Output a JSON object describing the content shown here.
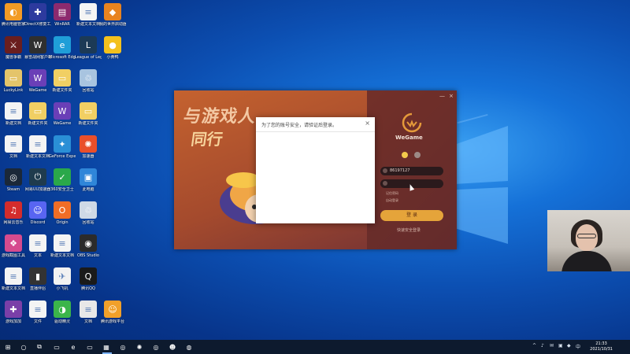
{
  "desktop": {
    "icons": [
      {
        "label": "腾讯电脑管家",
        "color": "#f29b25",
        "glyph": "◐"
      },
      {
        "label": "DirectX修复工具",
        "color": "#2d3a9e",
        "glyph": "✚"
      },
      {
        "label": "WinRAR",
        "color": "#8c2a6e",
        "glyph": "▤"
      },
      {
        "label": "新建文本文档",
        "color": "#f4f4f4",
        "glyph": "≡"
      },
      {
        "label": "我的世界启动器",
        "color": "#e8831f",
        "glyph": "◆"
      },
      {
        "label": "魔兽争霸",
        "color": "#6a1e1e",
        "glyph": "⚔"
      },
      {
        "label": "暴雪战网客户端",
        "color": "#2f2f2f",
        "glyph": "W"
      },
      {
        "label": "Microsoft Edge",
        "color": "#1f9ed8",
        "glyph": "e"
      },
      {
        "label": "League of Legends",
        "color": "#1c3a56",
        "glyph": "L"
      },
      {
        "label": "小黄鸭",
        "color": "#f3c11d",
        "glyph": "●"
      },
      {
        "label": "LuckyLink",
        "color": "#e4c46a",
        "glyph": "▭"
      },
      {
        "label": "WeGame",
        "color": "#6a3fb7",
        "glyph": "W"
      },
      {
        "label": "新建文件夹",
        "color": "#f1cf63",
        "glyph": "▭"
      },
      {
        "label": "回收站",
        "color": "#a8c4e0",
        "glyph": "♲"
      },
      {
        "label": "新建文档",
        "color": "#f4f4f4",
        "glyph": "≡"
      },
      {
        "label": "新建文件夹",
        "color": "#f1cf63",
        "glyph": "▭"
      },
      {
        "label": "WeGame",
        "color": "#6a3fb7",
        "glyph": "W"
      },
      {
        "label": "新建文件夹",
        "color": "#f1cf63",
        "glyph": "▭"
      },
      {
        "label": "文档",
        "color": "#f4f4f4",
        "glyph": "≡"
      },
      {
        "label": "新建文本文档",
        "color": "#f4f4f4",
        "glyph": "≡"
      },
      {
        "label": "GeForce Experience",
        "color": "#2a8fd6",
        "glyph": "✦"
      },
      {
        "label": "加速器",
        "color": "#e94f2a",
        "glyph": "✺"
      },
      {
        "label": "Steam",
        "color": "#1b2838",
        "glyph": "◎"
      },
      {
        "label": "网易UU加速器",
        "color": "#1f3b4d",
        "glyph": "⏻"
      },
      {
        "label": "360安全卫士",
        "color": "#2aa84a",
        "glyph": "✓"
      },
      {
        "label": "此电脑",
        "color": "#2f86d9",
        "glyph": "▣"
      },
      {
        "label": "网易云音乐",
        "color": "#d42c2c",
        "glyph": "♫"
      },
      {
        "label": "Discord",
        "color": "#5865f2",
        "glyph": "☺"
      },
      {
        "label": "Origin",
        "color": "#f06d26",
        "glyph": "O"
      },
      {
        "label": "回收站",
        "color": "#cfd9e6",
        "glyph": "♲"
      },
      {
        "label": "游戏截图工具",
        "color": "#d64b8e",
        "glyph": "❖"
      },
      {
        "label": "文本",
        "color": "#f4f4f4",
        "glyph": "≡"
      },
      {
        "label": "新建文本文档",
        "color": "#f4f4f4",
        "glyph": "≡"
      },
      {
        "label": "OBS Studio",
        "color": "#2b2b2b",
        "glyph": "◉"
      },
      {
        "label": "新建文本文档",
        "color": "#f4f4f4",
        "glyph": "≡"
      },
      {
        "label": "直播伴侣",
        "color": "#333333",
        "glyph": "▮"
      },
      {
        "label": "小飞机",
        "color": "#f2f2f2",
        "glyph": "✈"
      },
      {
        "label": "腾讯QQ",
        "color": "#1a1a1a",
        "glyph": "Q"
      },
      {
        "label": "游戏加加",
        "color": "#7a3fa8",
        "glyph": "✚"
      },
      {
        "label": "文件",
        "color": "#f4f4f4",
        "glyph": "≡"
      },
      {
        "label": "驱动精灵",
        "color": "#3bb54a",
        "glyph": "◑"
      },
      {
        "label": "文档",
        "color": "#e8e8e8",
        "glyph": "≡"
      },
      {
        "label": "腾讯游戏平台",
        "color": "#f1a02a",
        "glyph": "☺"
      },
      {
        "label": "录屏",
        "color": "#2b2b2b",
        "glyph": "▣"
      }
    ]
  },
  "wegame_window": {
    "banner_line1": "与游戏人",
    "banner_line2": "同行",
    "brand": "WeGame",
    "minimize": "—",
    "close": "×",
    "account_value": "86197127",
    "password_value": "",
    "remember_label": "记住密码",
    "auto_login_label": "自动登录",
    "login_button": "登 录",
    "safe_link": "快速安全登录"
  },
  "dialog": {
    "title": "为了您的账号安全，请验证后登录。",
    "close": "×"
  },
  "taskbar": {
    "start": "⊞",
    "search": "○",
    "task_view": "⧉",
    "apps": [
      "▭",
      "e",
      "▭",
      "▦",
      "◎",
      "✺",
      "◎",
      "☻",
      "◍"
    ],
    "tray_icons": [
      "^",
      "♪",
      "✉",
      "▣",
      "◆",
      "中"
    ],
    "time": "21:33",
    "date": "2021/10/31"
  }
}
